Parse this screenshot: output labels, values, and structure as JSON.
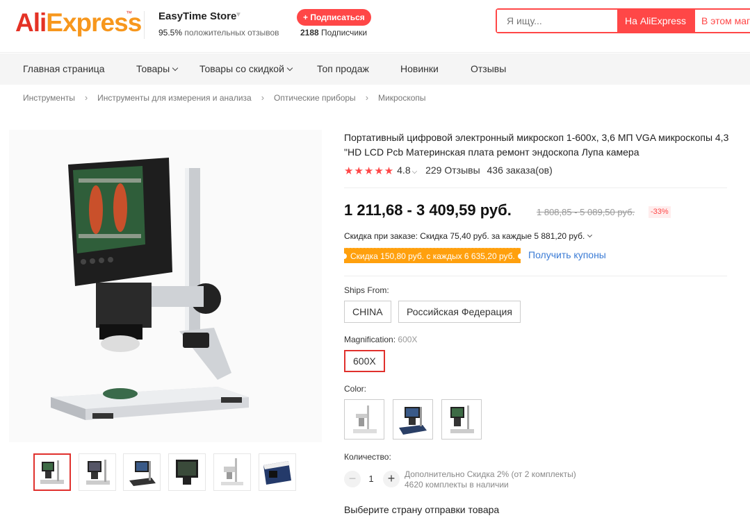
{
  "header": {
    "logo_text_ali": "Ali",
    "logo_text_express": "Express",
    "logo_tm": "™",
    "store_name": "EasyTime Store",
    "store_rating_value": "95.5%",
    "store_rating_text": "положительных отзывов",
    "subscribe_label": "+ Подписаться",
    "followers_count": "2188",
    "followers_label": "Подписчики",
    "search_placeholder": "Я ищу...",
    "search_ali_label": "На AliExpress",
    "search_store_label": "В этом магазине"
  },
  "nav": {
    "items": [
      {
        "label": "Главная страница"
      },
      {
        "label": "Товары"
      },
      {
        "label": "Товары со скидкой"
      },
      {
        "label": "Топ продаж"
      },
      {
        "label": "Новинки"
      },
      {
        "label": "Отзывы"
      }
    ]
  },
  "breadcrumb": [
    "Инструменты",
    "Инструменты для измерения и анализа",
    "Оптические приборы",
    "Микроскопы"
  ],
  "product": {
    "title": "Портативный цифровой электронный микроскоп 1-600x, 3,6 МП VGA микроскопы 4,3 \"HD LCD Pcb Материнская плата ремонт эндоскопа Лупа камера",
    "rating": "4.8",
    "reviews": "229 Отзывы",
    "orders": "436 заказа(ов)",
    "price": "1 211,68 - 3 409,59 руб.",
    "old_price": "1 808,85 - 5 089,50 руб.",
    "discount": "-33%",
    "order_discount": "Скидка при заказе: Скидка 75,40 руб. за каждые 5 881,20 руб.",
    "coupon_tag": "Скидка 150,80 руб. с каждых 6 635,20 руб.",
    "coupon_link": "Получить купоны",
    "ships_from_label": "Ships From:",
    "ships_from_options": [
      "CHINA",
      "Российская Федерация"
    ],
    "magnification_label": "Magnification:",
    "magnification_value": "600X",
    "magnification_options": [
      "600X"
    ],
    "color_label": "Color:",
    "quantity_label": "Количество:",
    "quantity_value": "1",
    "quantity_discount": "Дополнительно Скидка 2% (от 2 комплекты)",
    "quantity_stock": "4620 комплекты в наличии",
    "ship_prompt": "Выберите страну отправки товара"
  },
  "colors": {
    "accent": "#ff4747",
    "logo_red": "#e43225",
    "logo_orange": "#f7971d",
    "coupon": "#ffa00d",
    "link": "#3a7bd5"
  }
}
